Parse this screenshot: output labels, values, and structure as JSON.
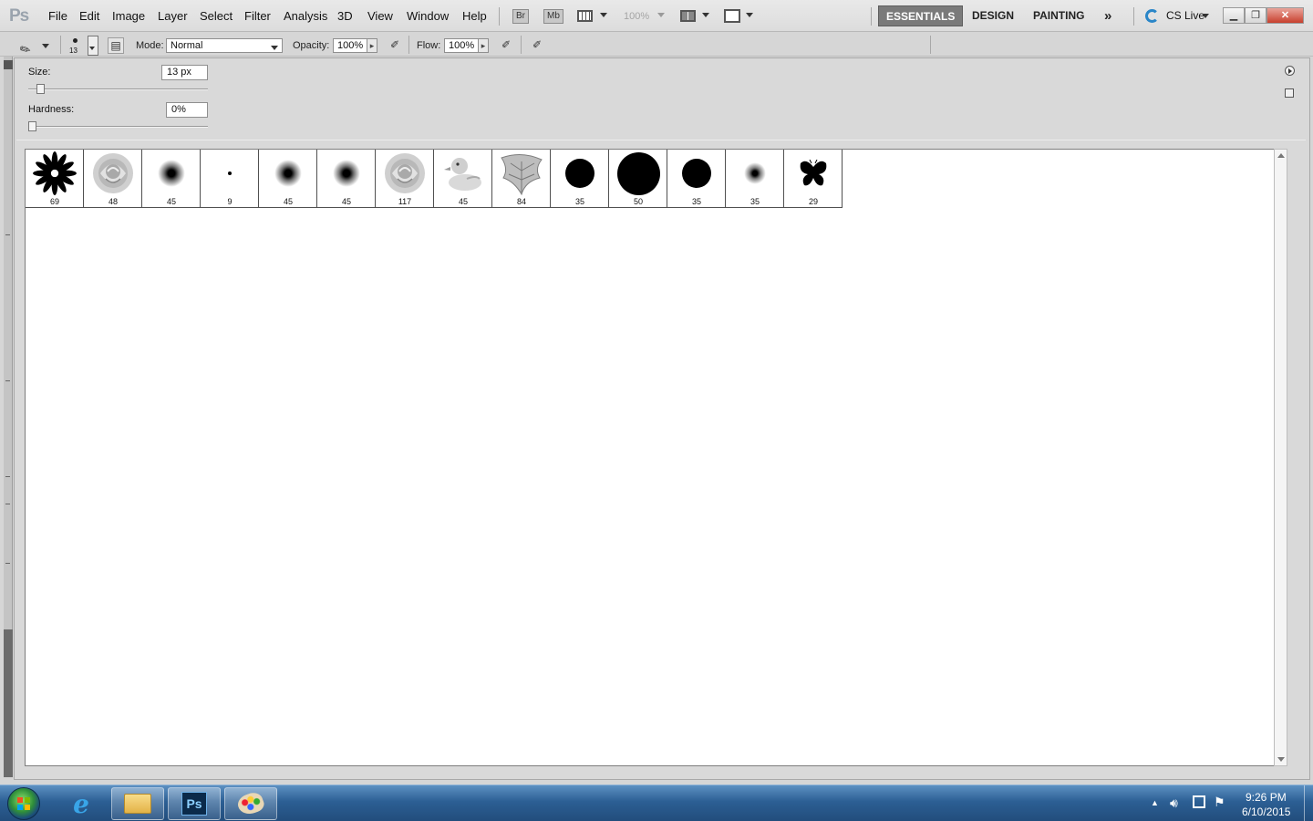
{
  "app": {
    "logo": "Ps",
    "menu": [
      "File",
      "Edit",
      "Image",
      "Layer",
      "Select",
      "Filter",
      "Analysis",
      "3D",
      "View",
      "Window",
      "Help"
    ],
    "bridge_label": "Br",
    "minibridge_label": "Mb",
    "zoom_level": "100%",
    "workspaces": [
      "ESSENTIALS",
      "DESIGN",
      "PAINTING"
    ],
    "active_workspace": "ESSENTIALS",
    "cs_live": "CS Live"
  },
  "options_bar": {
    "brush_size_small": "13",
    "mode_label": "Mode:",
    "mode_value": "Normal",
    "opacity_label": "Opacity:",
    "opacity_value": "100%",
    "flow_label": "Flow:",
    "flow_value": "100%"
  },
  "brush_picker": {
    "size_label": "Size:",
    "size_value": "13 px",
    "size_fraction": 0.05,
    "hardness_label": "Hardness:",
    "hardness_value": "0%",
    "hardness_fraction": 0.0,
    "presets": [
      {
        "kind": "starburst",
        "size": "69"
      },
      {
        "kind": "rose",
        "size": "48"
      },
      {
        "kind": "soft-round",
        "size": "45"
      },
      {
        "kind": "tiny-dot",
        "size": "9"
      },
      {
        "kind": "soft-round",
        "size": "45"
      },
      {
        "kind": "soft-round",
        "size": "45"
      },
      {
        "kind": "rose",
        "size": "117"
      },
      {
        "kind": "duck",
        "size": "45"
      },
      {
        "kind": "leaf",
        "size": "84"
      },
      {
        "kind": "hard-round",
        "size": "35"
      },
      {
        "kind": "hard-round-large",
        "size": "50"
      },
      {
        "kind": "hard-round",
        "size": "35"
      },
      {
        "kind": "soft-round-small",
        "size": "35"
      },
      {
        "kind": "butterfly",
        "size": "29"
      }
    ]
  },
  "taskbar": {
    "items": [
      "start",
      "internet-explorer",
      "file-explorer",
      "photoshop",
      "paint"
    ],
    "time": "9:26 PM",
    "date": "6/10/2015"
  },
  "colors": {
    "chrome": "#d6d6d6",
    "active_workspace": "#7a7a7a",
    "taskbar": "#2c5f94"
  }
}
